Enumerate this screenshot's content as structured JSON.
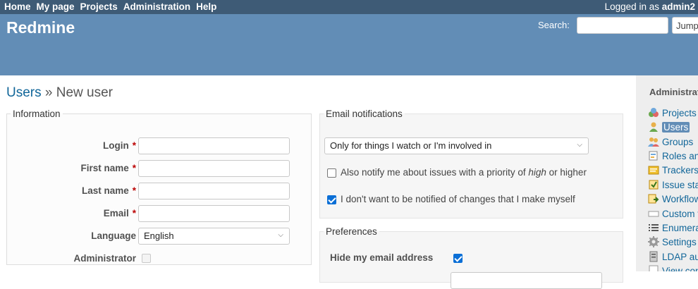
{
  "top_menu": {
    "links": [
      "Home",
      "My page",
      "Projects",
      "Administration",
      "Help"
    ],
    "logged_in_prefix": "Logged in as",
    "logged_in_user": "admin2"
  },
  "header": {
    "app_title": "Redmine",
    "search_label": "Search:",
    "search_value": "",
    "jump_label": "Jump"
  },
  "breadcrumb": {
    "parent": "Users",
    "separator": " » ",
    "current": "New user"
  },
  "information": {
    "legend": "Information",
    "login_label": "Login",
    "first_name_label": "First name",
    "last_name_label": "Last name",
    "email_label": "Email",
    "required_mark": "*",
    "language_label": "Language",
    "language_value": "English",
    "administrator_label": "Administrator",
    "administrator_checked": false
  },
  "email_notifications": {
    "legend": "Email notifications",
    "mode_value": "Only for things I watch or I'm involved in",
    "priority_text_prefix": "Also notify me about issues with a priority of ",
    "priority_value": "high",
    "priority_text_suffix": " or higher",
    "priority_checked": false,
    "no_self_notified_text": "I don't want to be notified of changes that I make myself",
    "no_self_notified_checked": true
  },
  "preferences": {
    "legend": "Preferences",
    "hide_mail_label": "Hide my email address",
    "hide_mail_checked": true
  },
  "sidebar": {
    "title": "Administration",
    "items": [
      {
        "label": "Projects",
        "icon": "projects-icon"
      },
      {
        "label": "Users",
        "icon": "user-icon"
      },
      {
        "label": "Groups",
        "icon": "group-icon"
      },
      {
        "label": "Roles and permissions",
        "icon": "roles-icon"
      },
      {
        "label": "Trackers",
        "icon": "tracker-icon"
      },
      {
        "label": "Issue statuses",
        "icon": "issue-status-icon"
      },
      {
        "label": "Workflow",
        "icon": "workflow-icon"
      },
      {
        "label": "Custom fields",
        "icon": "custom-fields-icon"
      },
      {
        "label": "Enumerations",
        "icon": "list-icon"
      },
      {
        "label": "Settings",
        "icon": "settings-icon"
      },
      {
        "label": "LDAP authentication",
        "icon": "server-icon"
      },
      {
        "label": "View configuration",
        "icon": "info-icon"
      }
    ],
    "selected": "Users"
  },
  "colors": {
    "top_menu_bg": "#3e5b76",
    "header_bg": "#628db6",
    "link": "#169",
    "required": "#bb0000",
    "sidebar_bg": "#eeeeee"
  }
}
